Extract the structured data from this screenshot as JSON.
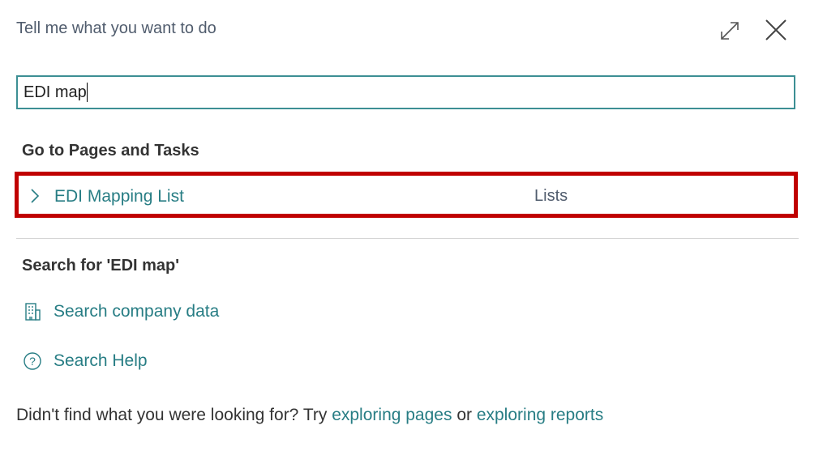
{
  "dialog": {
    "title": "Tell me what you want to do"
  },
  "search": {
    "value": "EDI map"
  },
  "pages_section": {
    "heading": "Go to Pages and Tasks",
    "results": [
      {
        "label": "EDI Mapping List",
        "category": "Lists"
      }
    ]
  },
  "search_section": {
    "heading": "Search for 'EDI map'",
    "actions": [
      {
        "label": "Search company data",
        "icon": "building-icon"
      },
      {
        "label": "Search Help",
        "icon": "help-circle-icon"
      }
    ]
  },
  "footer": {
    "prefix": "Didn't find what you were looking for? Try ",
    "link1": "exploring pages",
    "middle": " or ",
    "link2": "exploring reports"
  },
  "colors": {
    "accent": "#277d84",
    "highlight_border": "#c00000",
    "input_border": "#3c8f94"
  }
}
